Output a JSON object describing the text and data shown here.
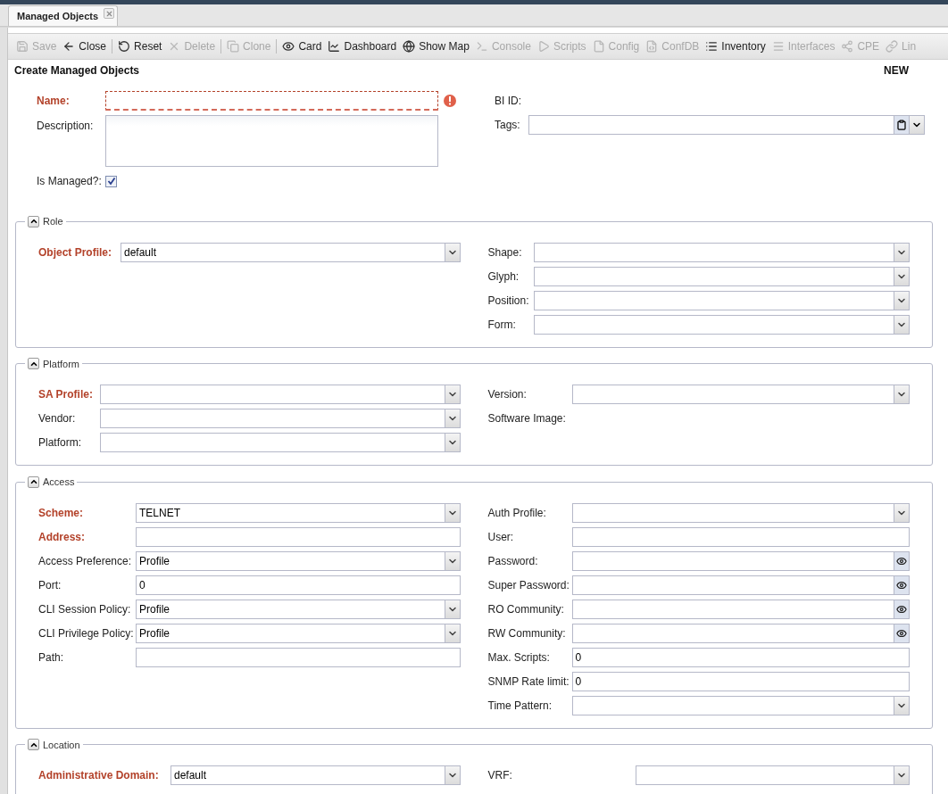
{
  "tabs": [
    {
      "label": "Managed Objects",
      "selected": true,
      "closable": true
    }
  ],
  "toolbar": [
    {
      "label": "Save",
      "disabled": true
    },
    {
      "label": "Close",
      "disabled": false
    },
    {
      "label": "Reset",
      "disabled": false
    },
    {
      "label": "Delete",
      "disabled": true
    },
    {
      "label": "Clone",
      "disabled": true
    },
    {
      "label": "Card",
      "disabled": false
    },
    {
      "label": "Dashboard",
      "disabled": false
    },
    {
      "label": "Show Map",
      "disabled": false
    },
    {
      "label": "Console",
      "disabled": true
    },
    {
      "label": "Scripts",
      "disabled": true
    },
    {
      "label": "Config",
      "disabled": true
    },
    {
      "label": "ConfDB",
      "disabled": true
    },
    {
      "label": "Inventory",
      "disabled": false
    },
    {
      "label": "Interfaces",
      "disabled": true
    },
    {
      "label": "CPE",
      "disabled": true
    },
    {
      "label": "Lin",
      "disabled": true
    }
  ],
  "form": {
    "title": "Create Managed Objects",
    "status": "NEW",
    "left": [
      {
        "kind": "text",
        "label": "Name:",
        "required": true,
        "invalid": true
      },
      {
        "kind": "textarea",
        "label": "Description:",
        "required": false
      },
      {
        "kind": "checkbox",
        "label": "Is Managed?:",
        "required": false,
        "checked": true
      }
    ],
    "right": [
      {
        "kind": "display",
        "label": "BI ID:",
        "required": false
      },
      {
        "kind": "tags",
        "label": "Tags:",
        "required": false
      }
    ]
  },
  "sections": [
    {
      "title": "Role",
      "expanded": true,
      "left": [
        {
          "kind": "combo",
          "label": "Object Profile:",
          "required": true,
          "value": "default"
        }
      ],
      "right": [
        {
          "kind": "combo",
          "label": "Shape:",
          "required": false
        },
        {
          "kind": "combo",
          "label": "Glyph:",
          "required": false
        },
        {
          "kind": "combo",
          "label": "Position:",
          "required": false
        },
        {
          "kind": "combo",
          "label": "Form:",
          "required": false
        }
      ]
    },
    {
      "title": "Platform",
      "expanded": true,
      "left": [
        {
          "kind": "combo",
          "label": "SA Profile:",
          "required": true
        },
        {
          "kind": "combo",
          "label": "Vendor:",
          "required": false
        },
        {
          "kind": "combo",
          "label": "Platform:",
          "required": false
        }
      ],
      "right": [
        {
          "kind": "combo",
          "label": "Version:",
          "required": false
        },
        {
          "kind": "display",
          "label": "Software Image:",
          "required": false
        }
      ]
    },
    {
      "title": "Access",
      "expanded": true,
      "left": [
        {
          "kind": "combo",
          "label": "Scheme:",
          "required": true,
          "value": "TELNET"
        },
        {
          "kind": "text",
          "label": "Address:",
          "required": true
        },
        {
          "kind": "combo",
          "label": "Access Preference:",
          "required": false,
          "value": "Profile"
        },
        {
          "kind": "text",
          "label": "Port:",
          "required": false,
          "value": "0"
        },
        {
          "kind": "combo",
          "label": "CLI Session Policy:",
          "required": false,
          "value": "Profile"
        },
        {
          "kind": "combo",
          "label": "CLI Privilege Policy:",
          "required": false,
          "value": "Profile"
        },
        {
          "kind": "text",
          "label": "Path:",
          "required": false
        }
      ],
      "right": [
        {
          "kind": "combo",
          "label": "Auth Profile:",
          "required": false
        },
        {
          "kind": "text",
          "label": "User:",
          "required": false
        },
        {
          "kind": "password",
          "label": "Password:",
          "required": false
        },
        {
          "kind": "password",
          "label": "Super Password:",
          "required": false
        },
        {
          "kind": "password",
          "label": "RO Community:",
          "required": false
        },
        {
          "kind": "password",
          "label": "RW Community:",
          "required": false
        },
        {
          "kind": "text",
          "label": "Max. Scripts:",
          "required": false,
          "value": "0"
        },
        {
          "kind": "text",
          "label": "SNMP Rate limit:",
          "required": false,
          "value": "0"
        },
        {
          "kind": "combo",
          "label": "Time Pattern:",
          "required": false
        }
      ]
    },
    {
      "title": "Location",
      "expanded": true,
      "left": [
        {
          "kind": "combo",
          "label": "Administrative Domain:",
          "required": true,
          "value": "default"
        }
      ],
      "right": [
        {
          "kind": "combo",
          "label": "VRF:",
          "required": false
        }
      ]
    }
  ]
}
